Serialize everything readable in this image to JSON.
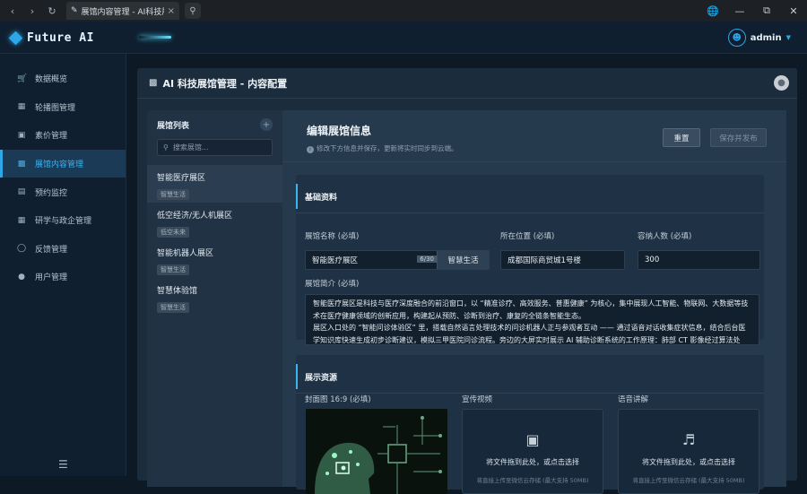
{
  "browser": {
    "tab_title": "展馆内容管理 - AI科技展馆"
  },
  "app": {
    "brand": "Future AI",
    "user_name": "admin"
  },
  "sidebar": {
    "items": [
      {
        "label": "数据概览",
        "icon": "cart-icon"
      },
      {
        "label": "轮播图管理",
        "icon": "building-icon"
      },
      {
        "label": "素价管理",
        "icon": "folder-icon"
      },
      {
        "label": "展馆内容管理",
        "icon": "screen-icon",
        "active": true
      },
      {
        "label": "预约监控",
        "icon": "calendar-icon"
      },
      {
        "label": "研学与政企管理",
        "icon": "building-icon"
      },
      {
        "label": "反馈管理",
        "icon": "chat-icon"
      },
      {
        "label": "用户管理",
        "icon": "user-icon"
      }
    ]
  },
  "page": {
    "title": "AI 科技展馆管理 - 内容配置"
  },
  "hall_list": {
    "title": "展馆列表",
    "search_placeholder": "搜索展馆...",
    "items": [
      {
        "name": "智能医疗展区",
        "tag": "智慧生活"
      },
      {
        "name": "低空经济/无人机展区",
        "tag": "低空未来"
      },
      {
        "name": "智能机器人展区",
        "tag": "智慧生活"
      },
      {
        "name": "智慧体验馆",
        "tag": "智慧生活"
      }
    ]
  },
  "editor": {
    "title": "编辑展馆信息",
    "subtitle": "修改下方信息并保存，更新将实时同步到云端。",
    "reset_label": "重置",
    "save_label": "保存并发布",
    "basic": {
      "heading": "基础资料",
      "name_label": "展馆名称 (必填)",
      "name_value": "智能医疗展区",
      "name_count": "6/30",
      "name_suffix": "智慧生活",
      "location_label": "所在位置 (必填)",
      "location_value": "成都国际商贸城1号楼",
      "capacity_label": "容纳人数 (必填)",
      "capacity_value": "300",
      "intro_label": "展馆简介 (必填)",
      "intro_value": "智能医疗展区是科技与医疗深度融合的前沿窗口，以 “精准诊疗、高效服务、普惠健康” 为核心，集中展现人工智能、物联网、大数据等技术在医疗健康领域的创新应用，构建起从预防、诊断到治疗、康复的全链条智能生态。\n展区入口处的 “智能问诊体验区” 里，搭载自然语言处理技术的问诊机器人正与参观者互动 —— 通过语音对话收集症状信息，结合后台医学知识库快速生成初步诊断建议，模拟三甲医院问诊流程。旁边的大屏实时展示 AI 辅助诊断系统的工作原理：肺部 CT 影像经过算法处理……"
    },
    "media": {
      "heading": "展示资源",
      "cover_label": "封面图 16:9 (必填)",
      "video_label": "宣传视频",
      "video_text": "将文件拖到此处，或点击选择",
      "video_hint": "将直接上传至微信云存储 (最大支持 50MB)",
      "audio_label": "语音讲解",
      "audio_text": "将文件拖到此处，或点击选择",
      "audio_hint": "将直接上传至微信云存储 (最大支持 50MB)"
    }
  }
}
